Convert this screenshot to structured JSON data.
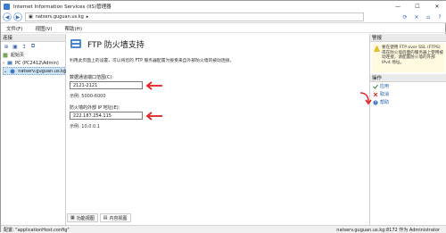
{
  "window": {
    "title": "Internet Information Services (IIS)管理器",
    "buttons": [
      "—",
      "☐",
      "✕"
    ]
  },
  "address": {
    "segments": [
      "natserv.guguan.us.kg",
      "▸"
    ]
  },
  "menu": [
    "文件(F)",
    "视图(V)",
    "帮助(H)"
  ],
  "left": {
    "header": "连接",
    "tree": [
      {
        "label": "起始页"
      },
      {
        "label": "PC (PC2412\\Admin)"
      },
      {
        "label": "natserv.guguan.us.kg"
      }
    ]
  },
  "center": {
    "title": "FTP 防火墙支持",
    "description": "利用此页面上的设置，可以将您的 FTP 服务器配置为接受来自外部防火墙的被动连接。",
    "port_range_label": "数据通道端口范围(C):",
    "port_range_value": "2121-2121",
    "port_range_hint": "示例: 5000-6000",
    "external_ip_label": "防火墙的外部 IP 地址(E):",
    "external_ip_value": "222.187.254.115",
    "external_ip_hint": "示例: 10.0.0.1"
  },
  "bottom_tabs": [
    "功能视图",
    "内容视图"
  ],
  "right": {
    "alert_header": "警报",
    "alert_text": "要在使用 FTP over SSL (FTPS)或在防火墙后面的服务器上使用被动连接，请配置防火墙的外部 IPv4 地址。",
    "actions_header": "操作",
    "actions": [
      {
        "label": "应用",
        "icon": "check-icon"
      },
      {
        "label": "取消",
        "icon": "cancel-icon"
      },
      {
        "label": "帮助",
        "icon": "help-icon"
      }
    ]
  },
  "status": {
    "left": "配置: \"applicationHost.config\"",
    "right": "natserv.guguan.us.kg:8172 作为 Administrator"
  },
  "colors": {
    "accent": "#1e5aa8",
    "red_arrow": "#e02020",
    "alert_bg": "#fffae0"
  }
}
